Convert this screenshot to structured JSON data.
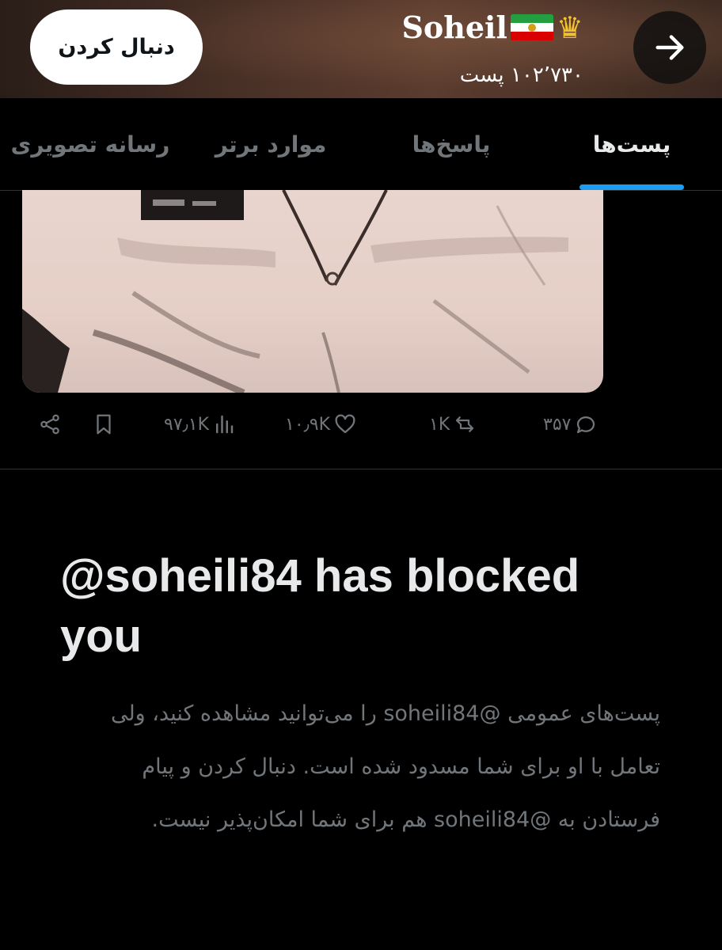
{
  "header": {
    "display_name": "Soheil",
    "name_emoji": [
      "iran-flag-icon",
      "crown-icon"
    ],
    "post_count": "۱۰۲٬۷۳۰ پست",
    "follow_label": "دنبال کردن"
  },
  "tabs": [
    {
      "label": "پست‌ها",
      "active": true
    },
    {
      "label": "پاسخ‌ها",
      "active": false
    },
    {
      "label": "موارد برتر",
      "active": false
    },
    {
      "label": "رسانه تصویری",
      "active": false
    }
  ],
  "post": {
    "replies": "۳۵۷",
    "reposts": "۱K",
    "likes": "۱۰٫۹K",
    "views": "۹۷٫۱K"
  },
  "blocked": {
    "title": "@soheili84 has blocked you",
    "description": "پست‌های عمومی @soheili84 را می‌توانید مشاهده کنید، ولی تعامل با او برای شما مسدود شده است. دنبال کردن و پیام فرستادن به @soheili84 هم برای شما امکان‌پذیر نیست."
  },
  "colors": {
    "accent": "#1d9bf0",
    "background": "#000000",
    "muted_text": "#71767b",
    "primary_text": "#e7e9ea"
  }
}
